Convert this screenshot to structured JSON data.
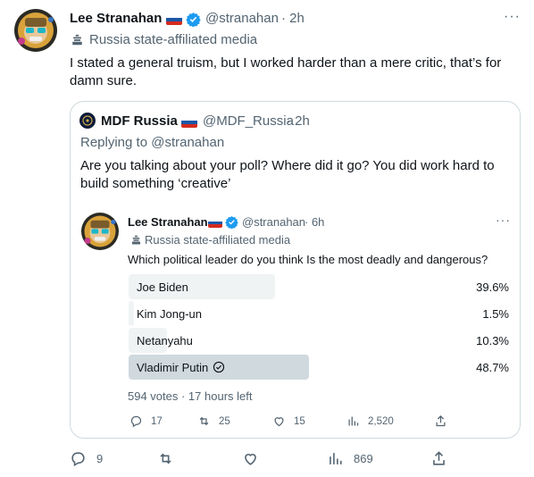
{
  "main_tweet": {
    "author_name": "Lee Stranahan",
    "handle": "@stranahan",
    "time": "· 2h",
    "label": "Russia state-affiliated media",
    "text_line1": "I stated a general truism, but I worked harder than a mere critic, that’s for",
    "text_line2": "damn sure.",
    "more": "···",
    "actions": {
      "replies": "9",
      "retweets": "",
      "likes": "",
      "views": "869"
    }
  },
  "quoted_tweet": {
    "author_name": "MDF Russia",
    "handle": "@MDF_Russia",
    "time": "· 2h",
    "replying_to": "Replying to @stranahan",
    "text_line1": "Are you talking about your poll? Where did it go? You did work hard to",
    "text_line2": "build something ‘creative’"
  },
  "inner_tweet": {
    "author_name": "Lee Stranahan",
    "handle": "@stranahan",
    "time": "· 6h",
    "label": "Russia state-affiliated media",
    "question": "Which political leader do you think Is the most deadly and dangerous?",
    "more": "···",
    "poll": {
      "options": [
        {
          "label": "Joe Biden",
          "percent": "39.6%",
          "value": 39.6
        },
        {
          "label": "Kim Jong-un",
          "percent": "1.5%",
          "value": 1.5
        },
        {
          "label": "Netanyahu",
          "percent": "10.3%",
          "value": 10.3
        },
        {
          "label": "Vladimir Putin",
          "percent": "48.7%",
          "value": 48.7,
          "winner": true
        }
      ],
      "summary": "594 votes · 17 hours left"
    },
    "actions": {
      "replies": "17",
      "retweets": "25",
      "likes": "15",
      "views": "2,520"
    }
  },
  "colors": {
    "verified": "#1d9bf0",
    "muted": "#536471",
    "poll_winner": "#cfd9de",
    "poll_other": "#eff3f4"
  }
}
